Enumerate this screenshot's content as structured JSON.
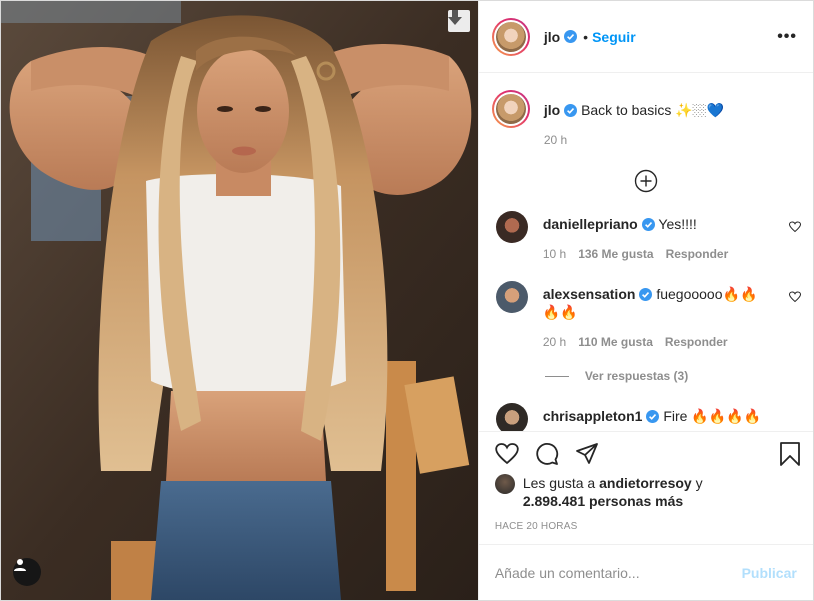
{
  "header": {
    "username": "jlo",
    "separator": "•",
    "follow_label": "Seguir",
    "more_label": "•••"
  },
  "caption": {
    "username": "jlo",
    "text": "Back to basics ✨🏼💙",
    "time": "20 h"
  },
  "comments": [
    {
      "username": "daniellepriano",
      "text": "Yes!!!!",
      "time": "10 h",
      "likes": "136 Me gusta",
      "reply_label": "Responder"
    },
    {
      "username": "alexsensation",
      "text": "fuegooooo🔥🔥🔥🔥",
      "time": "20 h",
      "likes": "110 Me gusta",
      "reply_label": "Responder",
      "view_replies": "Ver respuestas (3)"
    },
    {
      "username": "chrisappleton1",
      "text": "Fire 🔥🔥🔥🔥"
    }
  ],
  "likes": {
    "prefix": "Les gusta a",
    "liker": "andietorresoy",
    "connector": "y",
    "count": "2.898.481 personas más"
  },
  "posted_ago": "HACE 20 HORAS",
  "add_comment": {
    "placeholder": "Añade un comentario...",
    "publish_label": "Publicar"
  },
  "colors": {
    "link_blue": "#0095f6",
    "publish_disabled": "#b2dffc",
    "muted": "#8e8e8e",
    "text": "#262626"
  },
  "icons": [
    "download-icon",
    "user-tag-icon",
    "more-options-icon",
    "verified-badge-icon",
    "load-more-plus-icon",
    "heart-icon",
    "comment-icon",
    "share-icon",
    "bookmark-icon"
  ]
}
